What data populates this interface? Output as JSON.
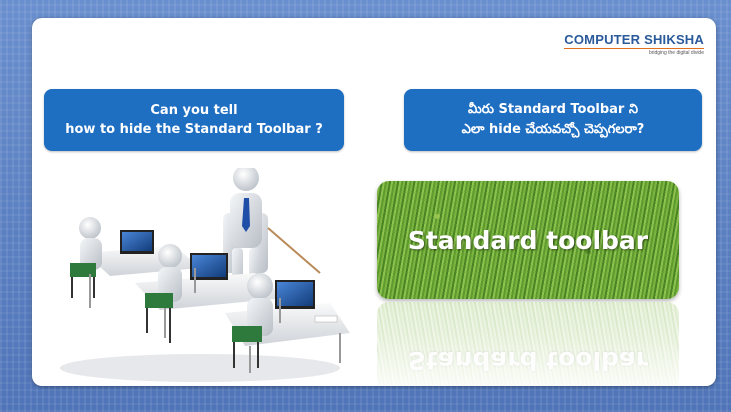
{
  "logo": {
    "name": "COMPUTER SHIKSHA",
    "tagline": "bridging the digital divide"
  },
  "question_english": {
    "line1": "Can you tell",
    "line2": "how to hide the Standard Toolbar ?"
  },
  "question_telugu": {
    "line1": "మీరు Standard Toolbar ని",
    "line2": "ఎలా hide చేయవచ్చో చెప్పగలరా?"
  },
  "grass_image": {
    "text": "Standard toolbar"
  },
  "illustration": {
    "icon": "classroom-computers-illustration"
  },
  "colors": {
    "bubble": "#1e6ec2",
    "background": "#5b7fbf"
  }
}
